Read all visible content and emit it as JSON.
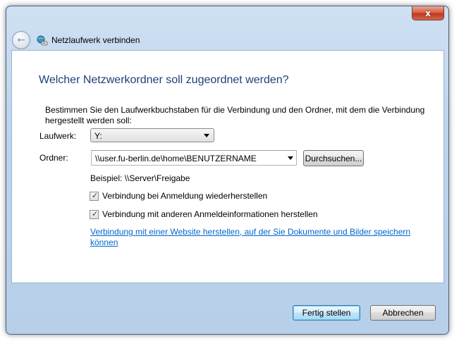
{
  "window": {
    "title": "Netzlaufwerk verbinden",
    "close_glyph": "x"
  },
  "main": {
    "heading": "Welcher Netzwerkordner soll zugeordnet werden?",
    "instruction": "Bestimmen Sie den Laufwerkbuchstaben für die Verbindung und den Ordner, mit dem die Verbindung hergestellt werden soll:",
    "drive_label": "Laufwerk:",
    "drive_value": "Y:",
    "folder_label": "Ordner:",
    "folder_value": "\\\\user.fu-berlin.de\\home\\BENUTZERNAME",
    "browse_label": "Durchsuchen...",
    "example": "Beispiel: \\\\Server\\Freigabe",
    "checkbox_reconnect": {
      "label": "Verbindung bei Anmeldung wiederherstellen",
      "checked": true
    },
    "checkbox_credentials": {
      "label": "Verbindung mit anderen Anmeldeinformationen herstellen",
      "checked": true
    },
    "website_link": "Verbindung mit einer Website herstellen, auf der Sie Dokumente und Bilder speichern können"
  },
  "footer": {
    "finish_label": "Fertig stellen",
    "cancel_label": "Abbrechen"
  },
  "colors": {
    "heading": "#1d3f7a",
    "link": "#0066cc",
    "frame": "#bcd3ec"
  },
  "icons": [
    "back-arrow-icon",
    "network-drive-icon",
    "close-icon",
    "dropdown-arrow-icon",
    "checkmark-icon"
  ]
}
